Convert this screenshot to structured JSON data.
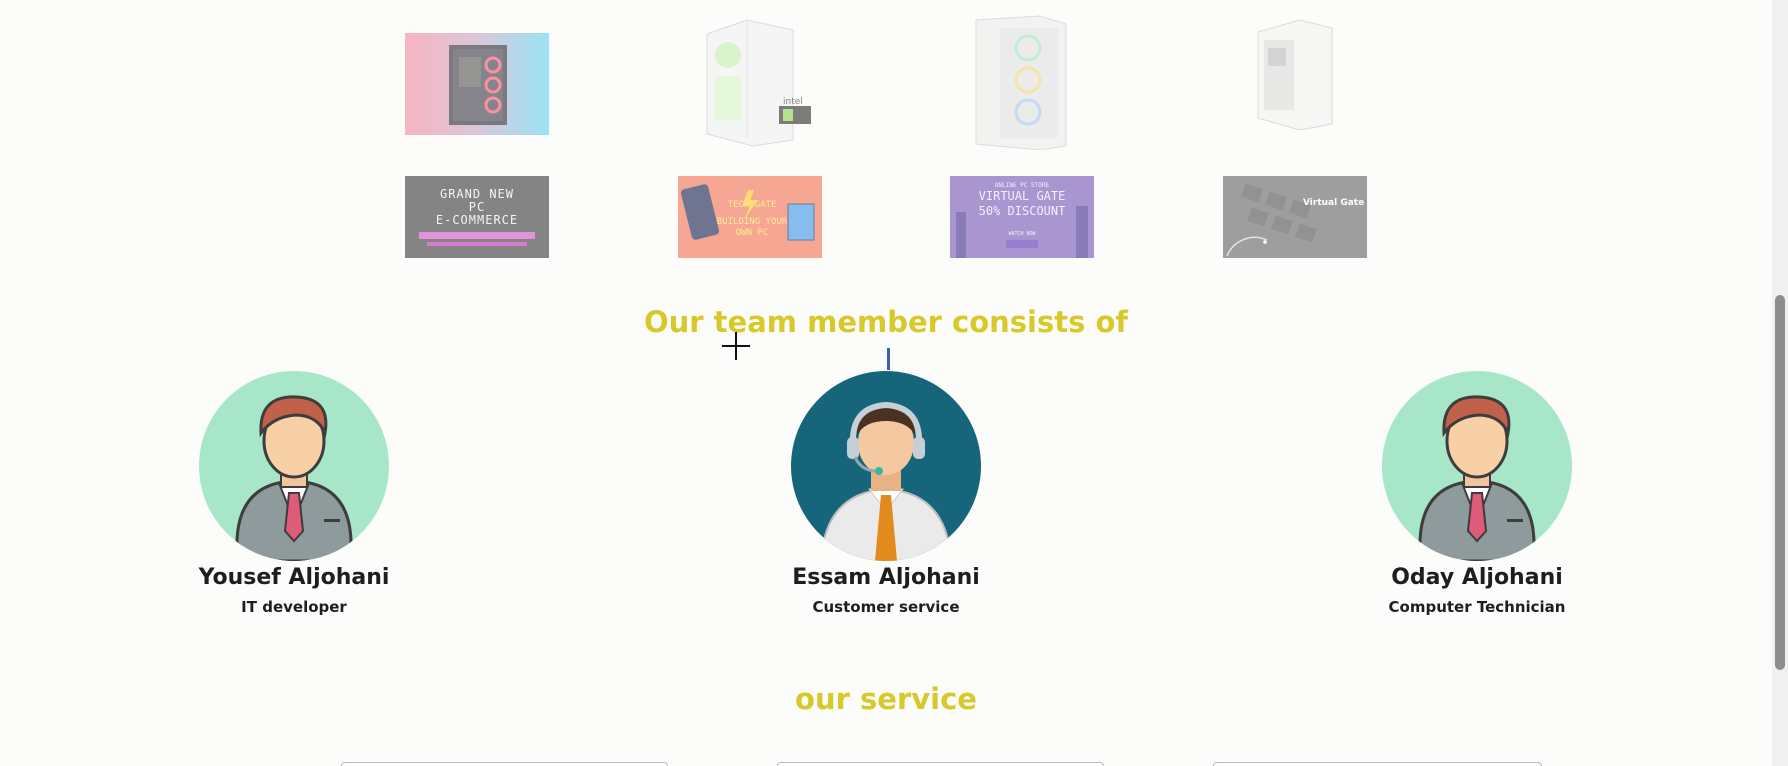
{
  "gallery": {
    "case_images": [
      {
        "icon": "pc-case-rgb-image"
      },
      {
        "icon": "pc-case-white-intel-image"
      },
      {
        "icon": "pc-case-white-mesh-image"
      },
      {
        "icon": "pc-case-white-glass-image"
      }
    ],
    "banners": [
      {
        "lines": [
          "GRAND NEW",
          "PC",
          "E-COMMERCE"
        ]
      },
      {
        "lines": [
          "TECH",
          "GATE",
          "BUILDING YOUR",
          "OWN PC"
        ]
      },
      {
        "lines": [
          "ONLINE PC STORE",
          "VIRTUAL GATE",
          "50% DISCOUNT",
          "WATCH NOW"
        ]
      },
      {
        "lines": [
          "Virtual Gate"
        ]
      }
    ],
    "intel_badge": "intel"
  },
  "team": {
    "heading": "Our team member consists of",
    "members": [
      {
        "name": "Yousef Aljohani",
        "role": "IT developer",
        "avatar_bg": "#a8e6c9"
      },
      {
        "name": "Essam Aljohani",
        "role": "Customer service",
        "avatar_bg": "#17657a"
      },
      {
        "name": "Oday Aljohani",
        "role": "Computer Technician",
        "avatar_bg": "#a8e6c9"
      }
    ]
  },
  "service": {
    "heading": "our service"
  },
  "colors": {
    "heading_accent": "#d8c92a",
    "text_dark": "#1e1e1e",
    "page_bg": "#fcfcfa"
  }
}
